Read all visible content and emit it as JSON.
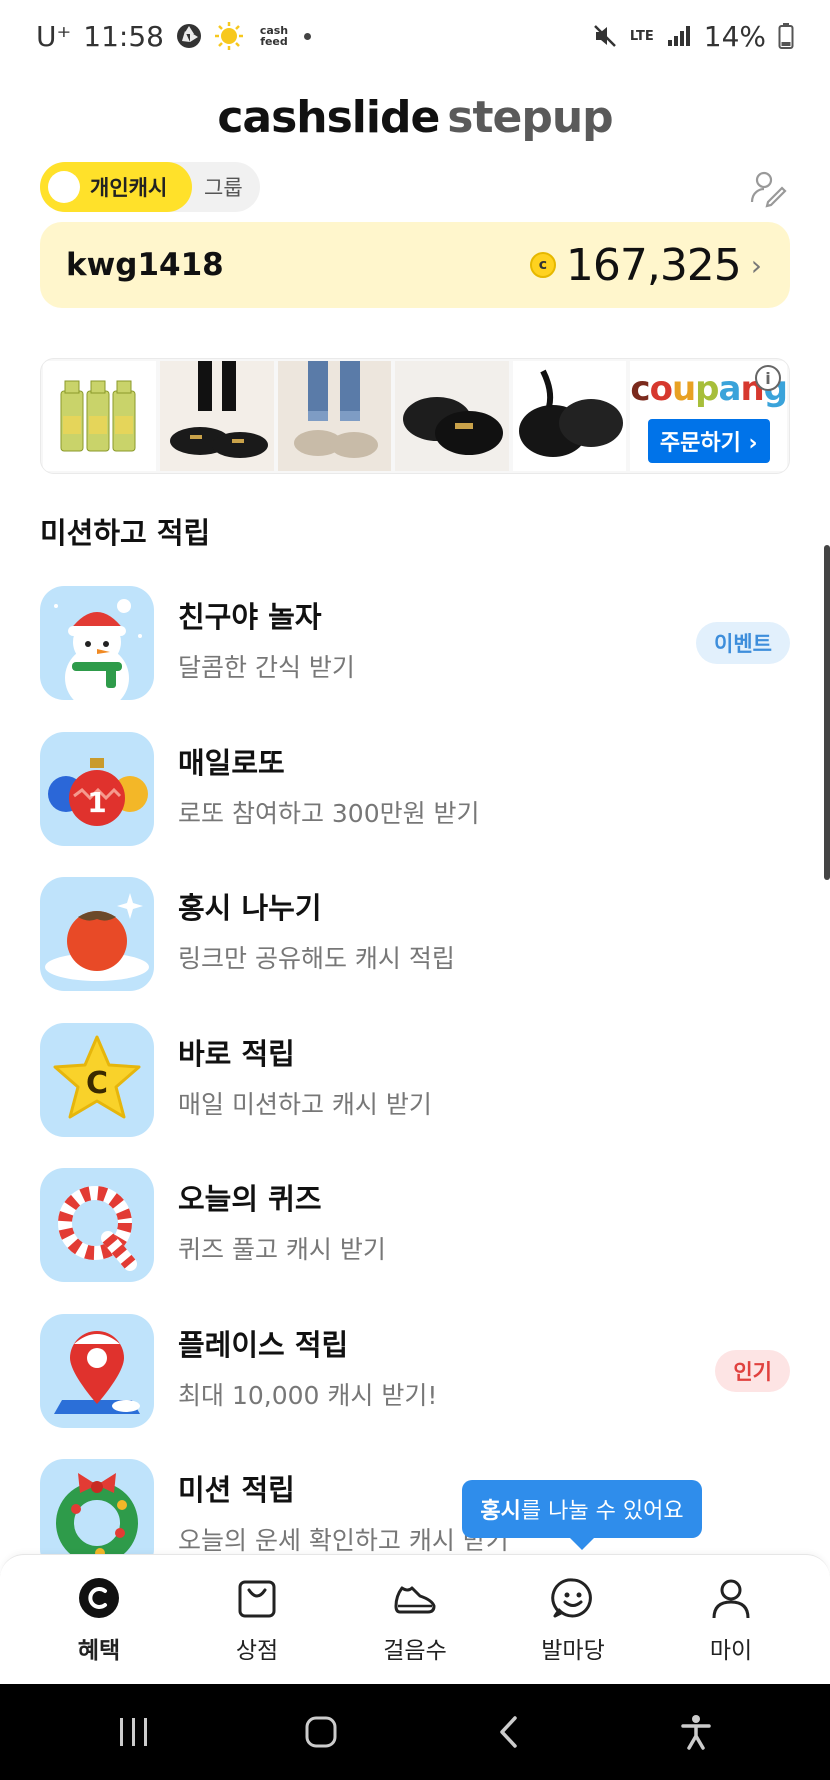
{
  "status_bar": {
    "carrier": "U⁺",
    "time": "11:58",
    "cashfeed_label_1": "cash",
    "cashfeed_label_2": "feed",
    "network": "LTE",
    "battery": "14%"
  },
  "header": {
    "title_main": "cashslide",
    "title_sub": "stepup"
  },
  "toggle": {
    "active_label": "개인캐시",
    "inactive_label": "그룹"
  },
  "user_card": {
    "user_id": "kwg1418",
    "coin_symbol": "c",
    "balance": "167,325",
    "chevron": "›"
  },
  "ad": {
    "brand": "coupang",
    "cta_label": "주문하기 ›",
    "info_label": "i",
    "products": [
      "juice-bottles",
      "black-mules",
      "beige-loafers",
      "black-loafers",
      "black-fur-shoes"
    ]
  },
  "section": {
    "title": "미션하고 적립"
  },
  "missions": [
    {
      "title": "친구야 놀자",
      "subtitle": "달콤한 간식 받기",
      "badge": "이벤트",
      "icon": "snowman-icon"
    },
    {
      "title": "매일로또",
      "subtitle": "로또 참여하고 300만원 받기",
      "badge": "",
      "icon": "lotto-balls-icon"
    },
    {
      "title": "홍시 나누기",
      "subtitle": "링크만 공유해도 캐시 적립",
      "badge": "",
      "icon": "persimmon-icon"
    },
    {
      "title": "바로 적립",
      "subtitle": "매일 미션하고 캐시 받기",
      "badge": "",
      "icon": "star-coin-icon"
    },
    {
      "title": "오늘의 퀴즈",
      "subtitle": "퀴즈 풀고 캐시 받기",
      "badge": "",
      "icon": "candy-cane-q-icon"
    },
    {
      "title": "플레이스 적립",
      "subtitle": "최대 10,000 캐시 받기!",
      "badge": "인기",
      "icon": "map-pin-icon"
    },
    {
      "title": "미션 적립",
      "subtitle": "오늘의 운세 확인하고 캐시 받기",
      "badge": "",
      "icon": "wreath-icon"
    }
  ],
  "tooltip": {
    "bold": "홍시",
    "rest": "를 나눌 수 있어요"
  },
  "bottom_nav": [
    {
      "label": "혜택",
      "icon": "cash-c-icon",
      "active": true
    },
    {
      "label": "상점",
      "icon": "shopping-bag-icon",
      "active": false
    },
    {
      "label": "걸음수",
      "icon": "sneaker-icon",
      "active": false
    },
    {
      "label": "발마당",
      "icon": "smiley-chat-icon",
      "active": false
    },
    {
      "label": "마이",
      "icon": "person-icon",
      "active": false
    }
  ],
  "colors": {
    "accent_yellow": "#FFE12A",
    "card_yellow": "#FFF6CC",
    "mission_bg": "#BFE3FB",
    "tooltip_blue": "#2F8DEB",
    "coupang_blue": "#0073E9"
  }
}
